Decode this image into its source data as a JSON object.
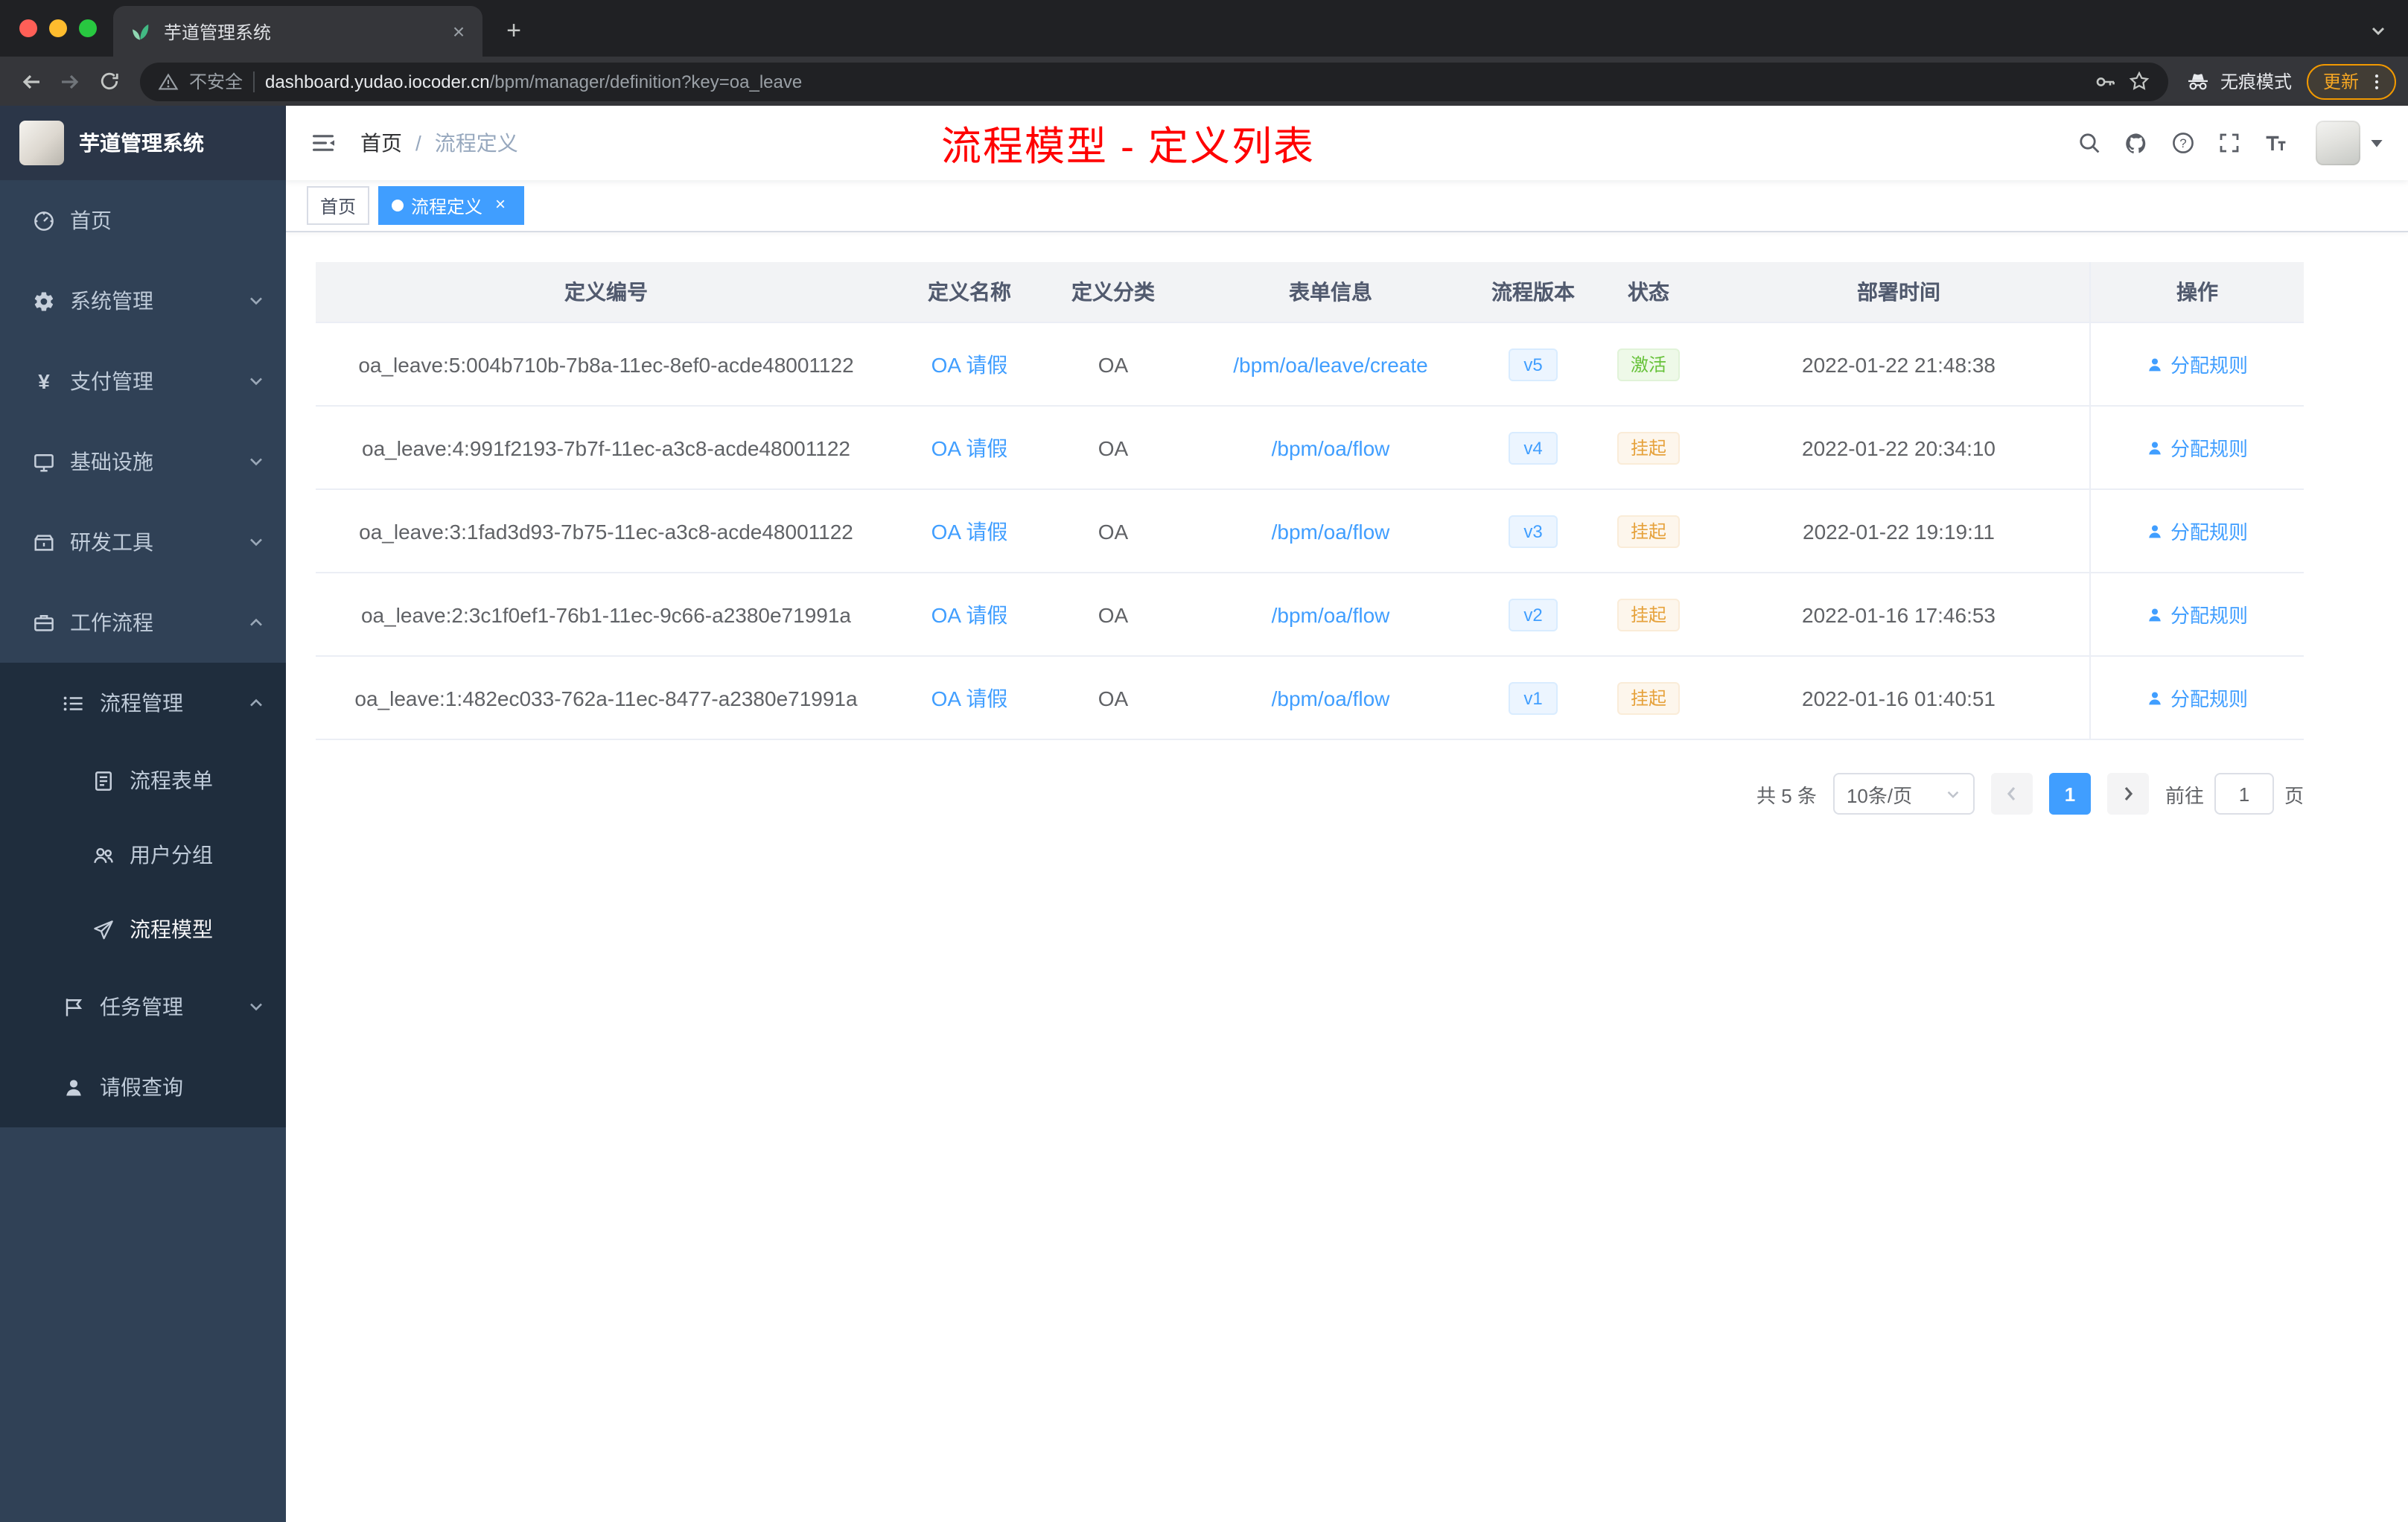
{
  "browser": {
    "tab_title": "芋道管理系统",
    "security_label": "不安全",
    "url_host": "dashboard.yudao.iocoder.cn",
    "url_path": "/bpm/manager/definition?key=oa_leave",
    "incognito_label": "无痕模式",
    "update_label": "更新"
  },
  "icons": {
    "close_glyph": "×",
    "plus_glyph": "+",
    "yen_glyph": "¥"
  },
  "sidebar": {
    "logo_title": "芋道管理系统",
    "items": [
      {
        "label": "首页"
      },
      {
        "label": "系统管理"
      },
      {
        "label": "支付管理"
      },
      {
        "label": "基础设施"
      },
      {
        "label": "研发工具"
      },
      {
        "label": "工作流程"
      },
      {
        "label": "流程管理"
      },
      {
        "label": "流程表单"
      },
      {
        "label": "用户分组"
      },
      {
        "label": "流程模型"
      },
      {
        "label": "任务管理"
      },
      {
        "label": "请假查询"
      }
    ]
  },
  "header": {
    "breadcrumb_home": "首页",
    "breadcrumb_sep": "/",
    "breadcrumb_current": "流程定义",
    "annotation": "流程模型 - 定义列表"
  },
  "tags": {
    "home": "首页",
    "active": "流程定义"
  },
  "table": {
    "columns": {
      "id": "定义编号",
      "name": "定义名称",
      "category": "定义分类",
      "form": "表单信息",
      "version": "流程版本",
      "status": "状态",
      "deploy_time": "部署时间",
      "actions": "操作"
    },
    "rows": [
      {
        "id": "oa_leave:5:004b710b-7b8a-11ec-8ef0-acde48001122",
        "name": "OA 请假",
        "category": "OA",
        "form": "/bpm/oa/leave/create",
        "version": "v5",
        "status": "激活",
        "time": "2022-01-22 21:48:38",
        "action": "分配规则"
      },
      {
        "id": "oa_leave:4:991f2193-7b7f-11ec-a3c8-acde48001122",
        "name": "OA 请假",
        "category": "OA",
        "form": "/bpm/oa/flow",
        "version": "v4",
        "status": "挂起",
        "time": "2022-01-22 20:34:10",
        "action": "分配规则"
      },
      {
        "id": "oa_leave:3:1fad3d93-7b75-11ec-a3c8-acde48001122",
        "name": "OA 请假",
        "category": "OA",
        "form": "/bpm/oa/flow",
        "version": "v3",
        "status": "挂起",
        "time": "2022-01-22 19:19:11",
        "action": "分配规则"
      },
      {
        "id": "oa_leave:2:3c1f0ef1-76b1-11ec-9c66-a2380e71991a",
        "name": "OA 请假",
        "category": "OA",
        "form": "/bpm/oa/flow",
        "version": "v2",
        "status": "挂起",
        "time": "2022-01-16 17:46:53",
        "action": "分配规则"
      },
      {
        "id": "oa_leave:1:482ec033-762a-11ec-8477-a2380e71991a",
        "name": "OA 请假",
        "category": "OA",
        "form": "/bpm/oa/flow",
        "version": "v1",
        "status": "挂起",
        "time": "2022-01-16 01:40:51",
        "action": "分配规则"
      }
    ]
  },
  "pagination": {
    "total": "共 5 条",
    "page_size": "10条/页",
    "current_page": "1",
    "goto_label": "前往",
    "goto_value": "1",
    "page_unit": "页"
  },
  "colors": {
    "primary": "#409eff",
    "success": "#67c23a",
    "warning": "#e6a23c",
    "annotation_red": "#ff0000",
    "sidebar_bg": "#304156",
    "sidebar_sub_bg": "#1f2d3d"
  }
}
